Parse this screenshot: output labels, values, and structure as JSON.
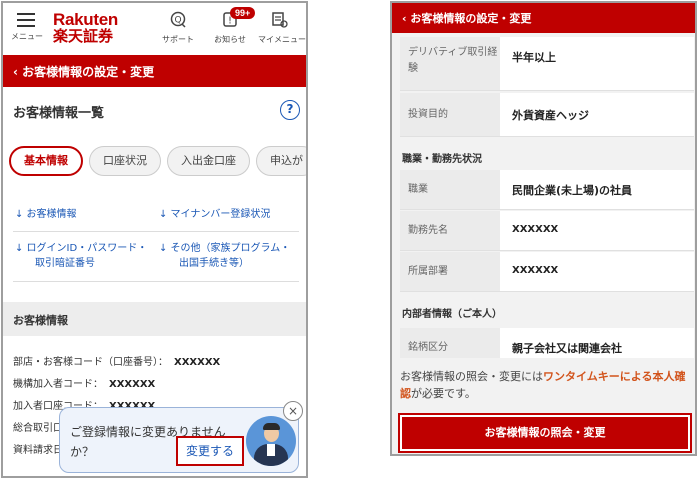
{
  "left": {
    "appbar": {
      "menu_label": "メニュー",
      "logo_en": "Rakuten",
      "logo_jp": "楽天証券",
      "support_label": "サポート",
      "notice_label": "お知らせ",
      "notice_badge": "99+",
      "mymenu_label": "マイメニュー"
    },
    "back_bar": "‹ お客様情報の設定・変更",
    "section_title": "お客様情報一覧",
    "help_icon": "?",
    "tabs": [
      {
        "label": "基本情報",
        "active": true
      },
      {
        "label": "口座状況",
        "active": false
      },
      {
        "label": "入出金口座",
        "active": false
      },
      {
        "label": "申込が",
        "active": false
      }
    ],
    "links": {
      "customer_info": "↓ お客様情報",
      "mynumber": "↓ マイナンバー登録状況",
      "login_line1": "↓ ログインID・パスワード・",
      "login_line2": "取引暗証番号",
      "other_line1": "↓ その他（家族プログラム・",
      "other_line2": "出国手続き等）"
    },
    "info_section": {
      "title": "お客様情報",
      "lines": [
        {
          "label": "部店・お客様コード（口座番号）：",
          "value": "XXXXXX"
        },
        {
          "label": "機構加入者コード：",
          "value": "XXXXXX"
        },
        {
          "label": "加入者口座コード：",
          "value": "XXXXXX"
        },
        {
          "label": "総合取引口",
          "value": ""
        },
        {
          "label": "資料請求日",
          "value": ""
        }
      ]
    },
    "popup": {
      "message": "ご登録情報に変更ありませんか？",
      "change_button": "変更する",
      "close": "×"
    }
  },
  "right": {
    "back_bar": "‹ お客様情報の設定・変更",
    "rows_top": [
      {
        "label": "デリバティブ取引経験",
        "value": "半年以上"
      },
      {
        "label": "投資目的",
        "value": "外貨資産ヘッジ"
      }
    ],
    "work_heading": "職業・勤務先状況",
    "rows_work": [
      {
        "label": "職業",
        "value": "民間企業(未上場)の社員"
      },
      {
        "label": "勤務先名",
        "value": "XXXXXX"
      },
      {
        "label": "所属部署",
        "value": "XXXXXX"
      }
    ],
    "insider_heading": "内部者情報（ご本人）",
    "rows_insider": [
      {
        "label": "銘柄区分",
        "value": "親子会社又は関連会社"
      }
    ],
    "note_pre": "お客様情報の照会・変更には",
    "note_highlight": "ワンタイムキーによる本人確認",
    "note_post": "が必要です。",
    "main_button": "お客様情報の照会・変更"
  },
  "colors": {
    "brand": "#bf0000",
    "link": "#1a57b5",
    "highlight": "#d2541c"
  }
}
